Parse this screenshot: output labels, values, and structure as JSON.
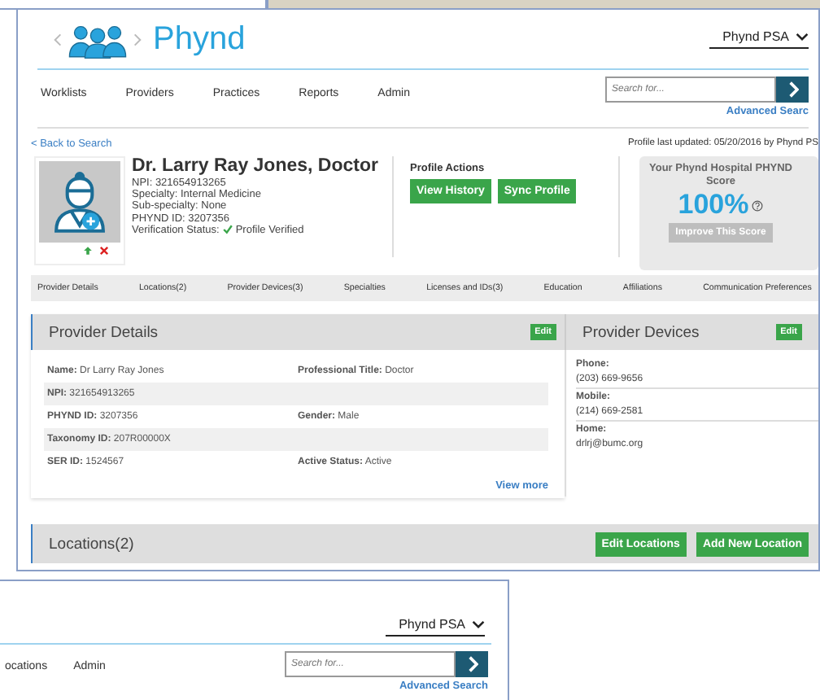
{
  "header": {
    "brand": "Phynd",
    "account": "Phynd PSA"
  },
  "nav": [
    "Worklists",
    "Providers",
    "Practices",
    "Reports",
    "Admin"
  ],
  "search": {
    "placeholder": "Search for...",
    "advanced_link": "Advanced Searc"
  },
  "back_link": "< Back to Search",
  "last_updated": "Profile last updated: 05/20/2016 by Phynd PS",
  "profile": {
    "name": "Dr. Larry Ray Jones, Doctor",
    "details": [
      "NPI: 321654913265",
      "Specialty: Internal Medicine",
      "Sub-specialty: None",
      "PHYND ID: 3207356"
    ],
    "verification_label": "Verification Status:",
    "verified": true,
    "verification": "Profile Verified"
  },
  "profile_actions": {
    "title": "Profile Actions",
    "buttons": [
      "View History",
      "Sync Profile"
    ]
  },
  "score": {
    "title": "Your Phynd Hospital PHYND",
    "subtitle": "Score",
    "value": "100%",
    "button": "Improve This Score"
  },
  "tabs": [
    "Provider Details",
    "Locations(2)",
    "Provider Devices(3)",
    "Specialties",
    "Licenses and IDs(3)",
    "Education",
    "Affiliations",
    "Communication Preferences"
  ],
  "provider_details": {
    "title": "Provider Details",
    "edit": "Edit",
    "rows": [
      {
        "cells": [
          "**Name:** Dr Larry Ray Jones",
          "**Professional Title:** Doctor"
        ]
      },
      {
        "cells": [
          "**NPI:** 321654913265"
        ]
      },
      {
        "cells": [
          "**PHYND ID:** 3207356",
          "**Gender:** Male"
        ]
      },
      {
        "cells": [
          "**Taxonomy ID:** 207R00000X"
        ]
      },
      {
        "cells": [
          "**SER ID:** 1524567",
          "**Active Status:** Active"
        ]
      }
    ],
    "more": "View more"
  },
  "provider_devices": {
    "title": "Provider Devices",
    "edit": "Edit",
    "items": [
      {
        "label": "Phone:",
        "value": "(203) 669-9656"
      },
      {
        "label": "Mobile:",
        "value": "(214) 669-2581"
      },
      {
        "label": "Home:",
        "value": "drlrj@bumc.org"
      }
    ]
  },
  "locations": {
    "title": "Locations(2)",
    "buttons": [
      "Edit Locations",
      "Add New Location"
    ]
  },
  "second_window": {
    "account": "Phynd PSA",
    "nav": [
      "ocations",
      "Admin"
    ],
    "placeholder": "Search for...",
    "advanced_link": "Advanced Search"
  }
}
